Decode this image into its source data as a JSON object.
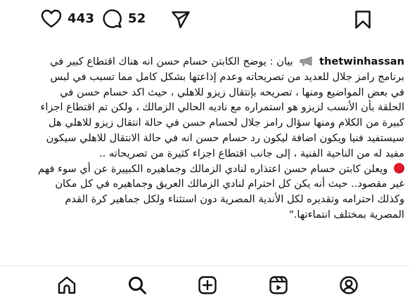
{
  "post_actions": {
    "likes_count": "443",
    "comments_count": "52",
    "like_icon": "heart-icon",
    "comment_icon": "comment-bubble-icon",
    "share_icon": "paper-plane-icon",
    "save_icon": "bookmark-icon"
  },
  "caption": {
    "username": "thetwinhassan",
    "intro_icon": "megaphone-icon",
    "paragraph_1": "بيان : يوضح الكابتن حسام حسن انه هناك اقتطاع كبير في  برنامج رامز جلال للعديد من تصريحاته وعدم إذاعتها بشكل كامل مما تسبب في لبس في بعض المواضيع ومنها ، تصريحه بإنتقال زيزو للاهلي ، حيث اكد حسام حسن في الحلقة بأن الأنسب لزيزو هو استمراره مع ناديه الحالي الزمالك ، ولكن تم اقتطاع اجزاء كبيرة من الكلام ومنها سؤال رامز جلال لحسام حسن في حالة انتقال زيزو للاهلي هل سيستفيد فنيا ويكون اضافة ليكون رد حسام حسن انه في حالة الانتقال للاهلي سيكون مفيد له من الناحية الفنية ، إلى جانب اقتطاع اجزاء كثيرة من تصريحاته ..",
    "bullet_icon": "red-circle-icon",
    "paragraph_2": "ويعلن كابتن حسام حسن اعتذاره لنادي الزمالك وجماهيره الكبييرة عن أي سوء فهم غير مقصود.. حيث أنه يكن كل احترام لنادي الزمالك العريق وجماهيره في كل مكان وكذلك احترامه وتقديره لكل الأندية المصرية دون استثناء ولكل جماهير كرة القدم المصرية بمختلف انتماءتها.\""
  },
  "bottom_nav": {
    "items": [
      "home-icon",
      "search-icon",
      "create-icon",
      "reels-icon",
      "profile-icon"
    ]
  },
  "colors": {
    "text": "#111111",
    "background": "#ffffff",
    "bullet_red": "#e0192d"
  }
}
